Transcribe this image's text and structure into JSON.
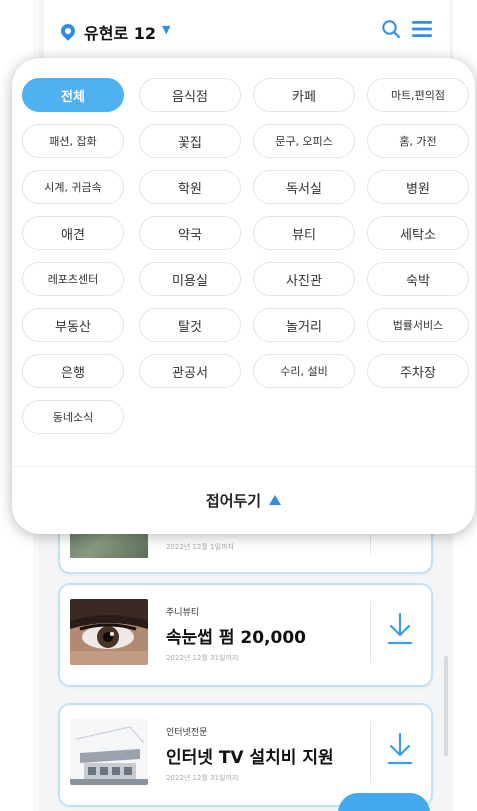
{
  "header": {
    "location": "유현로 12",
    "caret": "▼"
  },
  "categories": {
    "chips": [
      "전체",
      "음식점",
      "카페",
      "마트,편의점",
      "패션, 잡화",
      "꽃집",
      "문구, 오피스",
      "홈, 가전",
      "시계, 귀금속",
      "학원",
      "독서실",
      "병원",
      "애견",
      "약국",
      "뷰티",
      "세탁소",
      "레포츠센터",
      "미용실",
      "사진관",
      "숙박",
      "부동산",
      "탈것",
      "놀거리",
      "법률서비스",
      "은행",
      "관공서",
      "수리, 설비",
      "주차장",
      "동네소식"
    ],
    "active": "전체",
    "fold_label": "접어두기"
  },
  "cards": [
    {
      "date": "2022년 12월 1일까지"
    },
    {
      "business": "주니뷰티",
      "title": "속눈썹 펌 20,000",
      "date": "2022년 12월 31일까지",
      "thumb": "eye-photo"
    },
    {
      "business": "인터넷전문",
      "title": "인터넷 TV 설치비 지원",
      "date": "2022년 12월 31일까지",
      "thumb": "building-photo"
    }
  ],
  "colors": {
    "accent": "#4fb1f0",
    "brand_blue": "#2f8de4",
    "card_border": "#bfe3f6"
  },
  "icons": {
    "location": "location-pin-icon",
    "search": "search-icon",
    "menu": "hamburger-menu-icon",
    "download": "download-icon",
    "fold": "chevron-up-icon"
  }
}
